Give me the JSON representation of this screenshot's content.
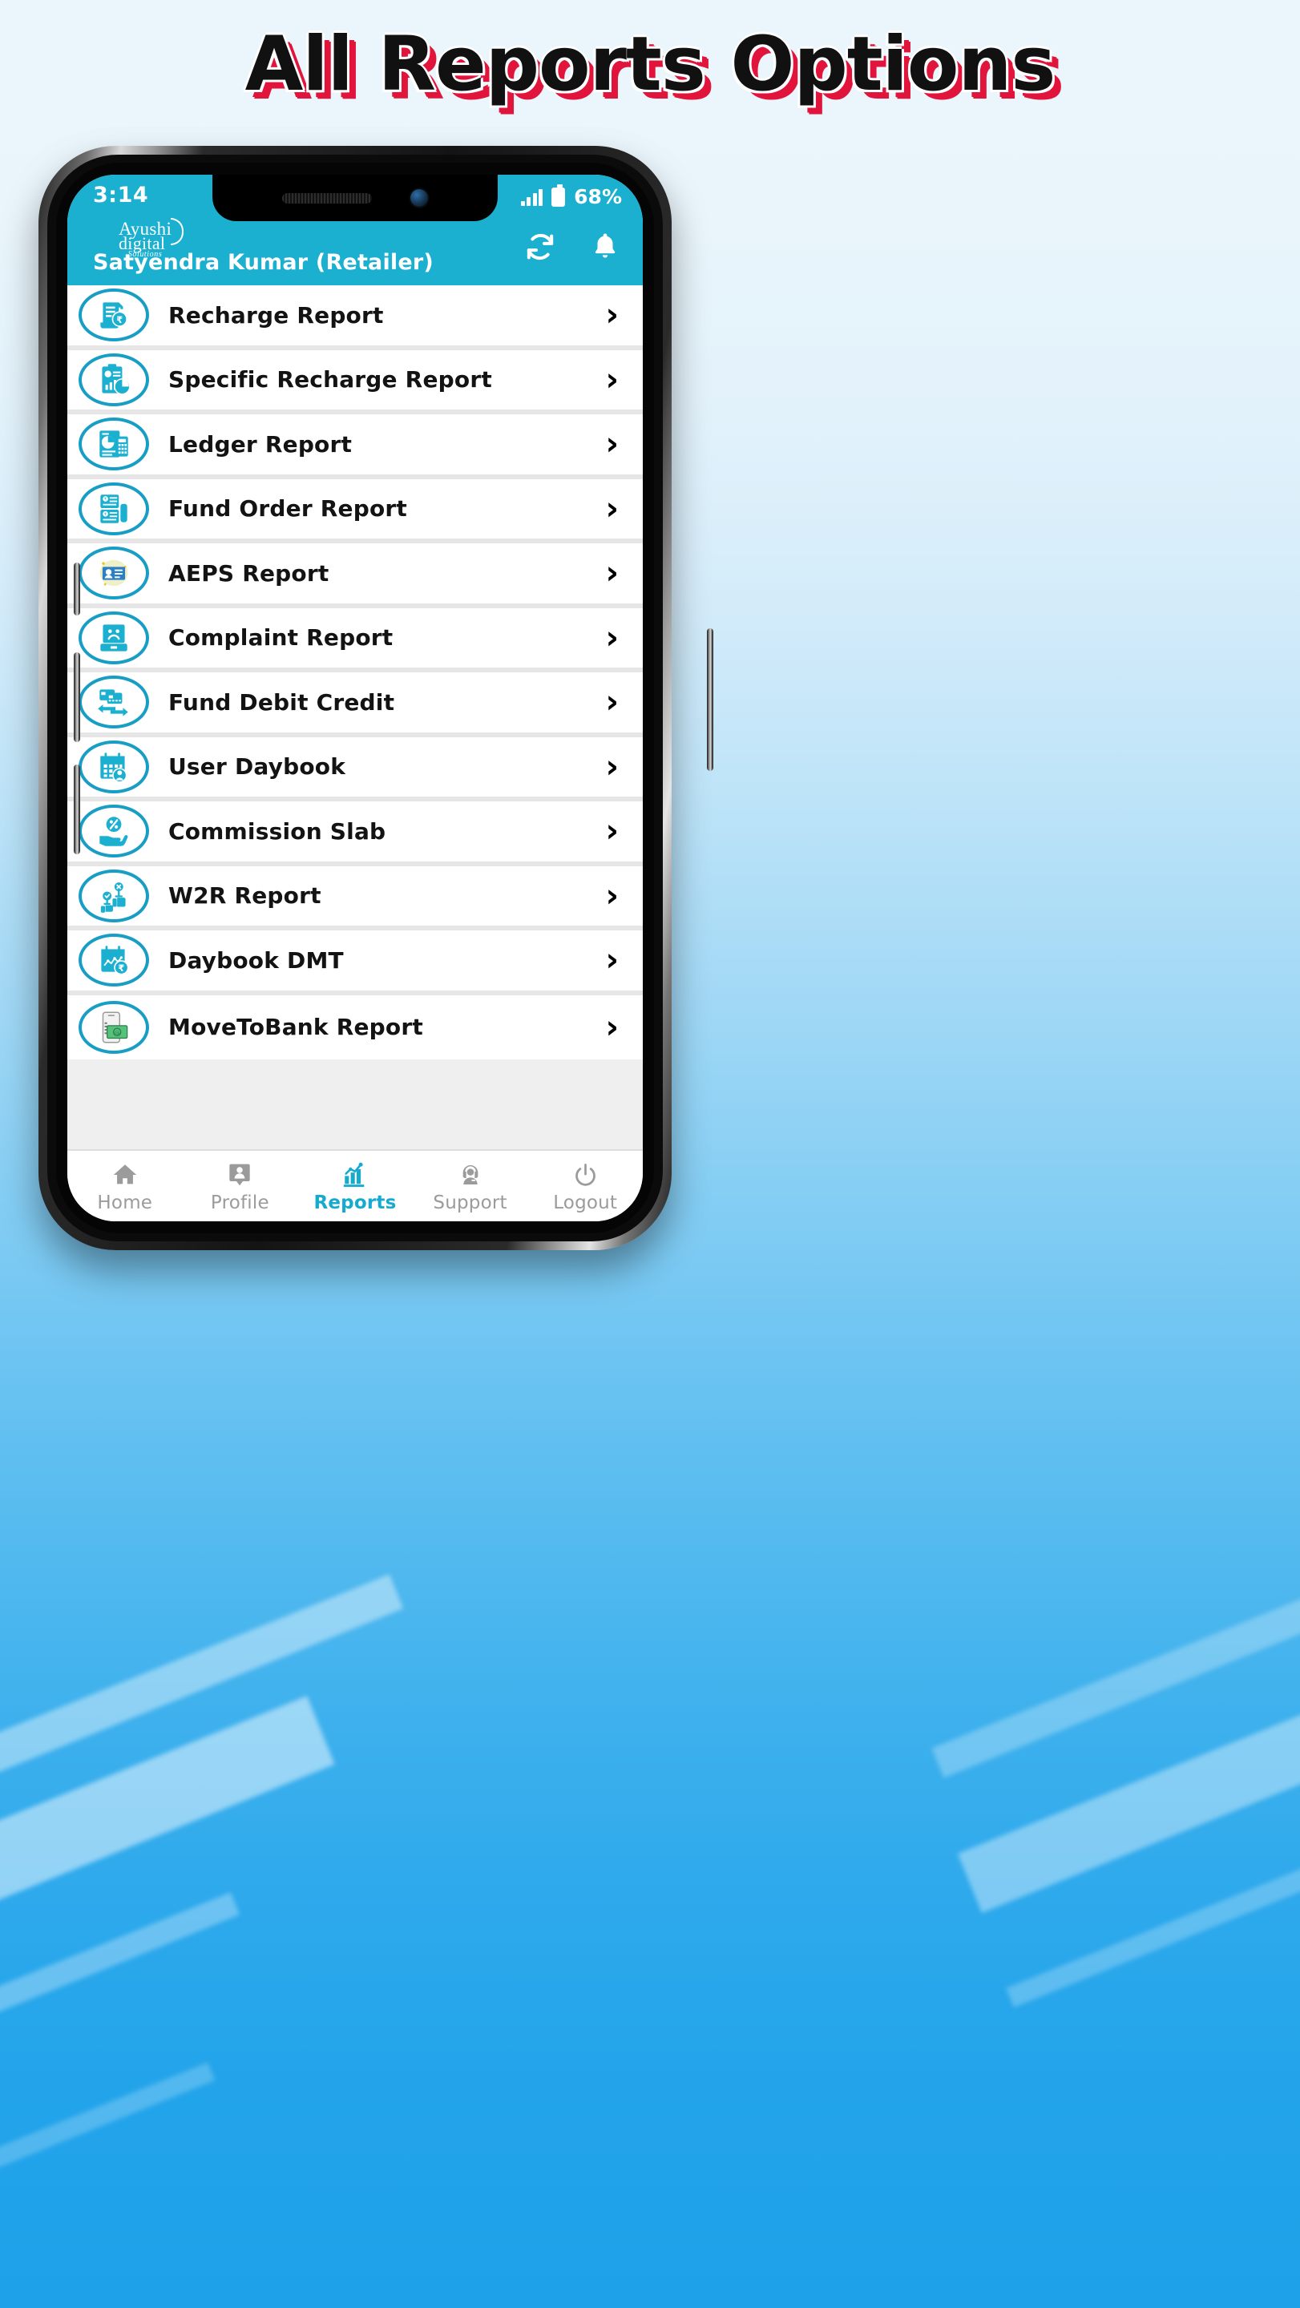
{
  "banner": {
    "title": "All Reports Options"
  },
  "colors": {
    "brand_cyan": "#1BAFD0",
    "icon_outline": "#189EC4",
    "active_tab": "#17AACF",
    "title_black": "#111111",
    "title_red": "#E1143C",
    "background_top": "#EAF6FC",
    "background_bottom": "#1EA1E9"
  },
  "status_bar": {
    "time": "3:14",
    "battery_percent": "68%",
    "signal_icon": "signal-bars-icon",
    "battery_icon": "battery-icon"
  },
  "app_bar": {
    "logo_main": "Ayushi",
    "logo_second": "digital",
    "logo_sub": "Solutions",
    "user_name": "Satyendra Kumar (Retailer)",
    "refresh_icon": "refresh-icon",
    "notification_icon": "bell-icon"
  },
  "reports": {
    "chevron": "›",
    "items": [
      {
        "label": "Recharge Report",
        "icon": "recharge-receipt-icon"
      },
      {
        "label": "Specific Recharge Report",
        "icon": "clipboard-chart-icon"
      },
      {
        "label": "Ledger Report",
        "icon": "ledger-piechart-icon"
      },
      {
        "label": "Fund Order Report",
        "icon": "fund-order-icon"
      },
      {
        "label": "AEPS Report",
        "icon": "aeps-idcard-icon"
      },
      {
        "label": "Complaint Report",
        "icon": "complaint-sadface-icon"
      },
      {
        "label": "Fund Debit Credit",
        "icon": "card-transfer-icon"
      },
      {
        "label": "User Daybook",
        "icon": "calendar-user-icon"
      },
      {
        "label": "Commission Slab",
        "icon": "hand-percent-icon"
      },
      {
        "label": "W2R Report",
        "icon": "thumbs-approval-icon"
      },
      {
        "label": "Daybook DMT",
        "icon": "calendar-rupee-icon"
      },
      {
        "label": "MoveToBank Report",
        "icon": "phone-money-icon"
      }
    ]
  },
  "tab_bar": {
    "tabs": [
      {
        "label": "Home",
        "icon": "home-icon",
        "active": false
      },
      {
        "label": "Profile",
        "icon": "profile-icon",
        "active": false
      },
      {
        "label": "Reports",
        "icon": "bar-chart-icon",
        "active": true
      },
      {
        "label": "Support",
        "icon": "headset-agent-icon",
        "active": false
      },
      {
        "label": "Logout",
        "icon": "power-icon",
        "active": false
      }
    ]
  },
  "android_nav": {
    "back_icon": "chevron-back-icon",
    "home_icon": "circle-home-icon",
    "recents_icon": "hamburger-recents-icon"
  }
}
